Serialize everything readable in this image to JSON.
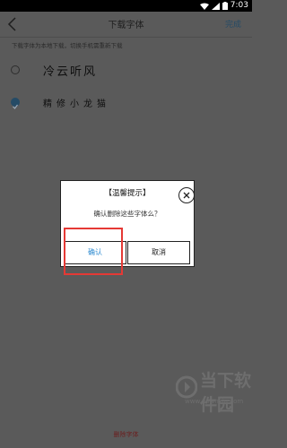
{
  "status_bar": {
    "time": "7:03"
  },
  "nav": {
    "title": "下载字体",
    "done_label": "完成"
  },
  "hint": "下载字体为本地下载，切换手机需重新下载",
  "fonts": [
    {
      "name": "冷云听风",
      "selected": false
    },
    {
      "name": "精修小龙猫",
      "selected": true
    }
  ],
  "delete_label": "删除字体",
  "dialog": {
    "title": "【温馨提示】",
    "message": "确认删除这些字体么？",
    "confirm_label": "确认",
    "cancel_label": "取消"
  },
  "watermark": {
    "name": "当下软件园",
    "url": "www.downxia.com"
  },
  "colors": {
    "accent": "#2d8ad0",
    "highlight": "#e53935",
    "overlay": "#5a5a5a"
  }
}
